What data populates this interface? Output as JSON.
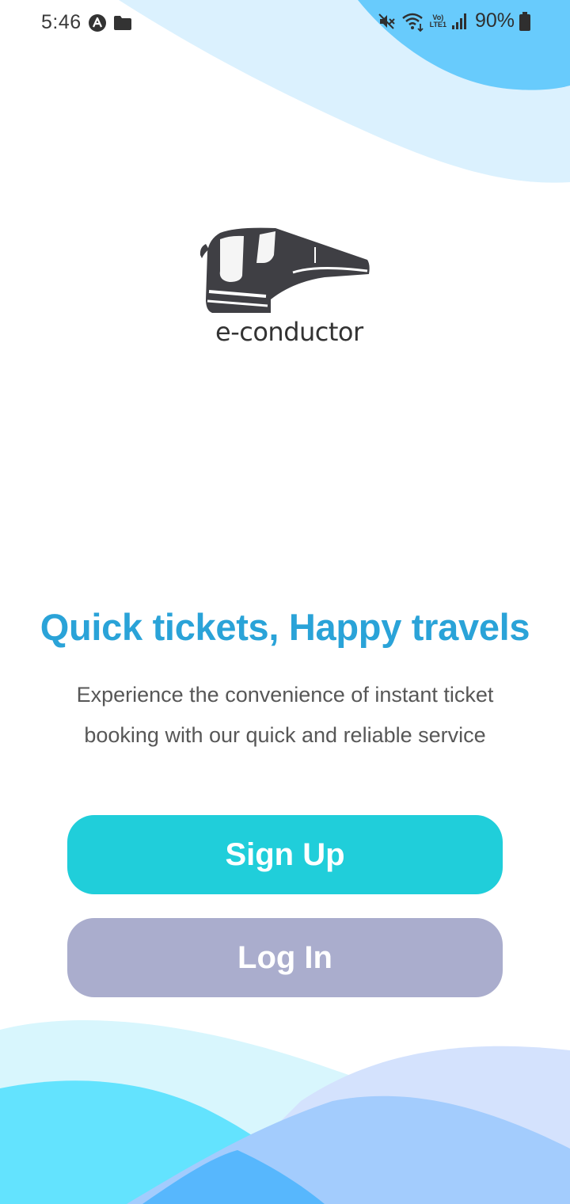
{
  "status_bar": {
    "time": "5:46",
    "battery": "90%",
    "network_label_top": "Vo)",
    "network_label_bottom": "LTE1",
    "icons": [
      "app-icon",
      "folder-icon",
      "mute-icon",
      "wifi-icon",
      "signal-icon",
      "battery-icon"
    ]
  },
  "logo": {
    "text": "e-conductor",
    "icon": "bus-icon"
  },
  "hero": {
    "headline": "Quick tickets, Happy travels",
    "description_line1": "Experience the convenience of instant ticket",
    "description_line2": "booking with our quick and reliable service"
  },
  "actions": {
    "signup_label": "Sign Up",
    "login_label": "Log In"
  },
  "colors": {
    "headline": "#2aa3d8",
    "signup_button": "#20ceda",
    "login_button": "#aaadcd",
    "wave_light": "#dbf1fe",
    "wave_mid": "#68cbfc"
  }
}
